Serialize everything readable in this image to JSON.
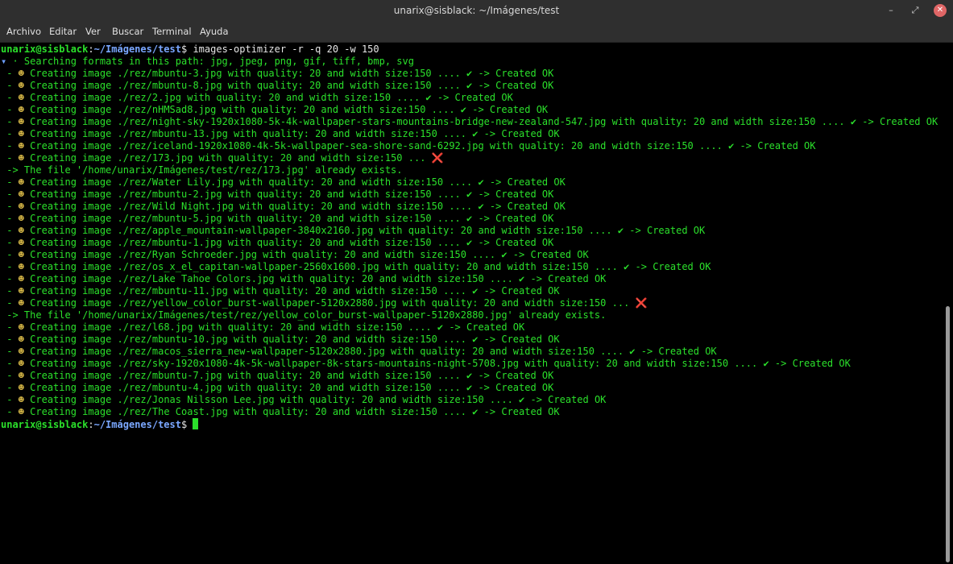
{
  "window": {
    "title": "unarix@sisblack: ~/Imágenes/test"
  },
  "controls": {
    "minimize_icon": "–",
    "restore_icon": "⤢",
    "close_icon": "✕"
  },
  "menu": [
    "Archivo",
    "Editar",
    "Ver",
    "Buscar",
    "Terminal",
    "Ayuda"
  ],
  "terminal": {
    "prompt_user": "unarix@sisblack",
    "prompt_sep": ":",
    "prompt_path": "~/Imágenes/test",
    "prompt_dollar": "$",
    "command": " images-optimizer -r -q 20 -w 150",
    "search_line": "· Searching formats in this path: jpg, jpeg, png, gif, tiff, bmp, svg",
    "lines": [
      {
        "type": "ok",
        "text": "Creating image ./rez/mbuntu-3.jpg with quality: 20 and width size:150 .... ✔ -> Created OK"
      },
      {
        "type": "ok",
        "text": "Creating image ./rez/mbuntu-8.jpg with quality: 20 and width size:150 .... ✔ -> Created OK"
      },
      {
        "type": "ok",
        "text": "Creating image ./rez/2.jpg with quality: 20 and width size:150 .... ✔ -> Created OK"
      },
      {
        "type": "ok",
        "text": "Creating image ./rez/nHMSad8.jpg with quality: 20 and width size:150 .... ✔ -> Created OK"
      },
      {
        "type": "ok",
        "text": "Creating image ./rez/night-sky-1920x1080-5k-4k-wallpaper-stars-mountains-bridge-new-zealand-547.jpg with quality: 20 and width size:150 .... ✔ -> Created OK"
      },
      {
        "type": "ok",
        "text": "Creating image ./rez/mbuntu-13.jpg with quality: 20 and width size:150 .... ✔ -> Created OK"
      },
      {
        "type": "ok",
        "text": "Creating image ./rez/iceland-1920x1080-4k-5k-wallpaper-sea-shore-sand-6292.jpg with quality: 20 and width size:150 .... ✔ -> Created OK"
      },
      {
        "type": "err",
        "text": "Creating image ./rez/173.jpg with quality: 20 and width size:150 ... "
      },
      {
        "type": "msg",
        "text": " -> The file '/home/unarix/Imágenes/test/rez/173.jpg' already exists."
      },
      {
        "type": "ok",
        "text": "Creating image ./rez/Water Lily.jpg with quality: 20 and width size:150 .... ✔ -> Created OK"
      },
      {
        "type": "ok",
        "text": "Creating image ./rez/mbuntu-2.jpg with quality: 20 and width size:150 .... ✔ -> Created OK"
      },
      {
        "type": "ok",
        "text": "Creating image ./rez/Wild Night.jpg with quality: 20 and width size:150 .... ✔ -> Created OK"
      },
      {
        "type": "ok",
        "text": "Creating image ./rez/mbuntu-5.jpg with quality: 20 and width size:150 .... ✔ -> Created OK"
      },
      {
        "type": "ok",
        "text": "Creating image ./rez/apple_mountain-wallpaper-3840x2160.jpg with quality: 20 and width size:150 .... ✔ -> Created OK"
      },
      {
        "type": "ok",
        "text": "Creating image ./rez/mbuntu-1.jpg with quality: 20 and width size:150 .... ✔ -> Created OK"
      },
      {
        "type": "ok",
        "text": "Creating image ./rez/Ryan Schroeder.jpg with quality: 20 and width size:150 .... ✔ -> Created OK"
      },
      {
        "type": "ok",
        "text": "Creating image ./rez/os_x_el_capitan-wallpaper-2560x1600.jpg with quality: 20 and width size:150 .... ✔ -> Created OK"
      },
      {
        "type": "ok",
        "text": "Creating image ./rez/Lake Tahoe Colors.jpg with quality: 20 and width size:150 .... ✔ -> Created OK"
      },
      {
        "type": "ok",
        "text": "Creating image ./rez/mbuntu-11.jpg with quality: 20 and width size:150 .... ✔ -> Created OK"
      },
      {
        "type": "err",
        "text": "Creating image ./rez/yellow_color_burst-wallpaper-5120x2880.jpg with quality: 20 and width size:150 ... "
      },
      {
        "type": "msg",
        "text": " -> The file '/home/unarix/Imágenes/test/rez/yellow_color_burst-wallpaper-5120x2880.jpg' already exists."
      },
      {
        "type": "ok",
        "text": "Creating image ./rez/l68.jpg with quality: 20 and width size:150 .... ✔ -> Created OK"
      },
      {
        "type": "ok",
        "text": "Creating image ./rez/mbuntu-10.jpg with quality: 20 and width size:150 .... ✔ -> Created OK"
      },
      {
        "type": "ok",
        "text": "Creating image ./rez/macos_sierra_new-wallpaper-5120x2880.jpg with quality: 20 and width size:150 .... ✔ -> Created OK"
      },
      {
        "type": "ok",
        "text": "Creating image ./rez/sky-1920x1080-4k-5k-wallpaper-8k-stars-mountains-night-5708.jpg with quality: 20 and width size:150 .... ✔ -> Created OK"
      },
      {
        "type": "ok",
        "text": "Creating image ./rez/mbuntu-7.jpg with quality: 20 and width size:150 .... ✔ -> Created OK"
      },
      {
        "type": "ok",
        "text": "Creating image ./rez/mbuntu-4.jpg with quality: 20 and width size:150 .... ✔ -> Created OK"
      },
      {
        "type": "ok",
        "text": "Creating image ./rez/Jonas Nilsson Lee.jpg with quality: 20 and width size:150 .... ✔ -> Created OK"
      },
      {
        "type": "ok",
        "text": "Creating image ./rez/The Coast.jpg with quality: 20 and width size:150 .... ✔ -> Created OK"
      }
    ],
    "bullet": " - ",
    "image_glyph": "☻",
    "search_glyph": "▾",
    "error_mark": "❌",
    "colors": {
      "output_green": "#2be02b",
      "prompt_blue": "#7aa7ff",
      "command_white": "#e6e6e6",
      "error_red": "#ff3b3b"
    }
  }
}
